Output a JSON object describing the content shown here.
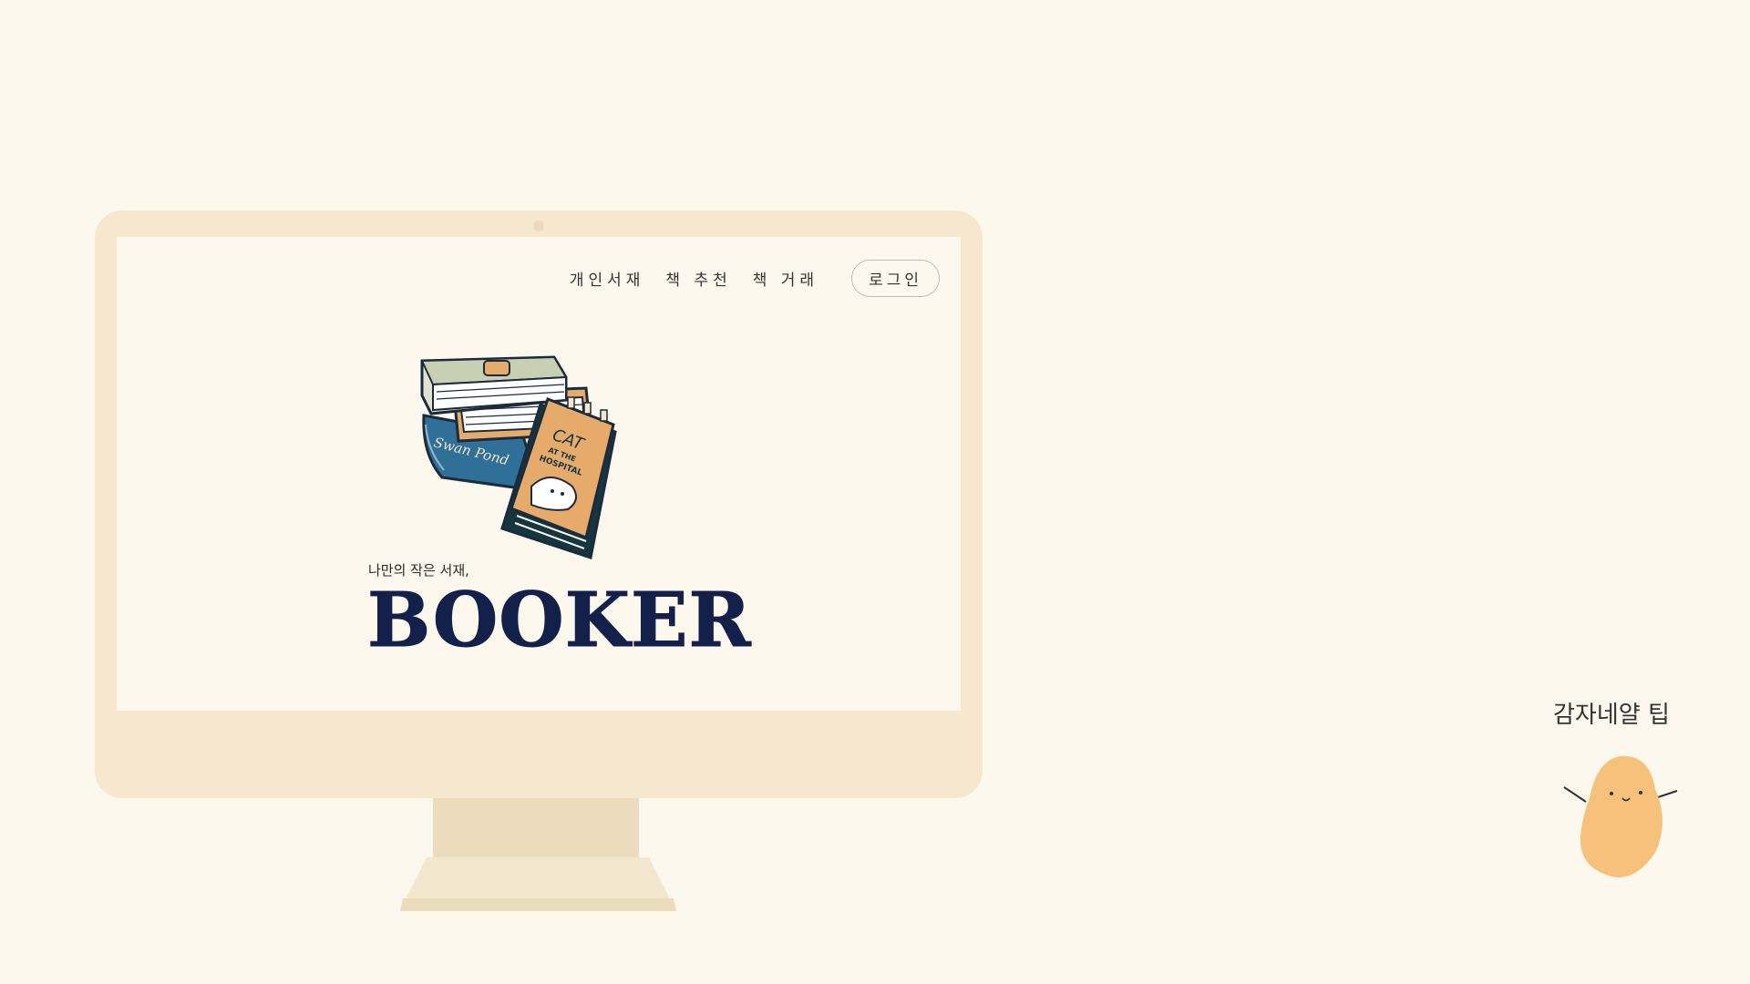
{
  "nav": {
    "items": [
      "개인서재",
      "책 추천",
      "책 거래"
    ],
    "login_label": "로그인"
  },
  "hero": {
    "tagline": "나만의 작은 서재,",
    "logo": "BOOKER",
    "book_titles": [
      "Swan Pond",
      "CAT",
      "AT THE",
      "HOSPITAL"
    ]
  },
  "tip": {
    "label": "감자네얄 팁"
  },
  "colors": {
    "background": "#fcf8ee",
    "monitor": "#f6e8cf",
    "logo": "#13204a",
    "mascot": "#f6c17a"
  }
}
